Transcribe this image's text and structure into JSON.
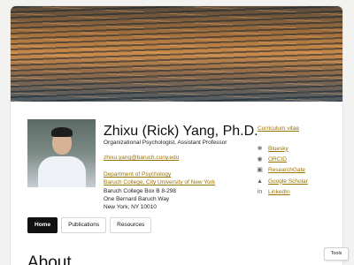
{
  "profile": {
    "name": "Zhixu (Rick) Yang, Ph.D.",
    "title": "Organizational Psychologist, Assistant Professor",
    "email": "zhixu.yang@baruch.cuny.edu",
    "department": "Department of Psychology",
    "institution": "Baruch College, City University of New York",
    "address": [
      "Baruch College Box B 8-298",
      "One Bernard Baruch Way",
      "New York, NY 10010"
    ]
  },
  "sidebar": {
    "cv_label": "Curriculum vitae",
    "links": [
      {
        "label": "Bluesky",
        "icon": "butterfly-icon"
      },
      {
        "label": "ORCID",
        "icon": "orcid-icon"
      },
      {
        "label": "ResearchGate",
        "icon": "researchgate-icon"
      },
      {
        "label": "Google Scholar",
        "icon": "graduation-cap-icon"
      },
      {
        "label": "LinkedIn",
        "icon": "linkedin-icon"
      }
    ]
  },
  "tabs": [
    {
      "label": "Home",
      "active": true
    },
    {
      "label": "Publications",
      "active": false
    },
    {
      "label": "Resources",
      "active": false
    }
  ],
  "section_heading": "About",
  "tools_label": "Tools",
  "colors": {
    "link": "#9a7300",
    "active_tab": "#111111",
    "background": "#f2f2f0"
  }
}
